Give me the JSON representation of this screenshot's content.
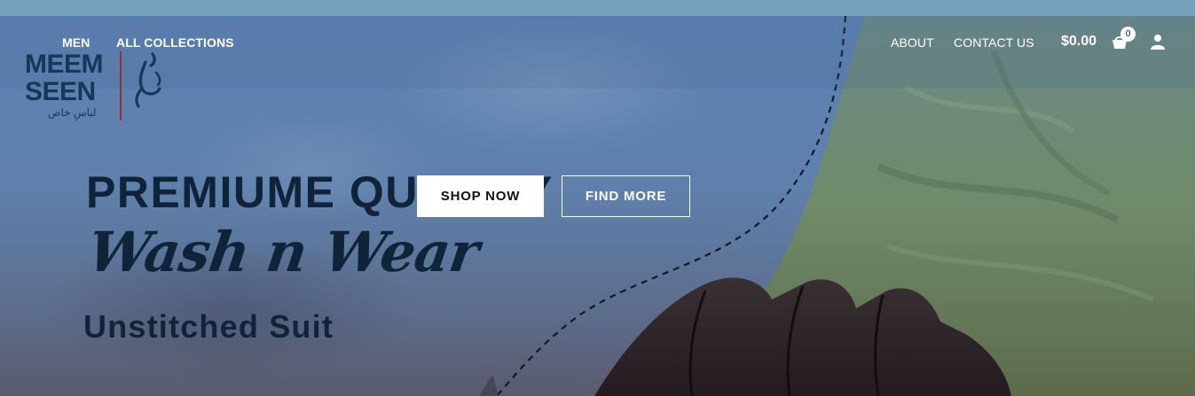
{
  "nav": {
    "left": [
      {
        "label": "MEN"
      },
      {
        "label": "ALL COLLECTIONS"
      }
    ],
    "right": [
      {
        "label": "ABOUT"
      },
      {
        "label": "CONTACT US"
      }
    ],
    "cart_total": "$0.00",
    "cart_count": "0",
    "icons": {
      "cart": "shopping-basket-icon",
      "user": "user-icon"
    }
  },
  "logo": {
    "line1": "MEEM",
    "line2": "SEEN",
    "tagline": "لباسِ خاص",
    "colors": {
      "text": "#13385a",
      "divider": "#9b2d3a"
    }
  },
  "hero": {
    "headline": "PREMIUME QUALITY",
    "script_title": "Wash n Wear",
    "subtitle": "Unstitched Suit",
    "buttons": {
      "shop": "SHOP NOW",
      "find": "FIND MORE"
    }
  },
  "colors": {
    "text_dark": "#0f2439",
    "topbar": "#76a1bd",
    "hero_blue": "#5c82b3",
    "fabric_green": "#6f8a6c"
  }
}
